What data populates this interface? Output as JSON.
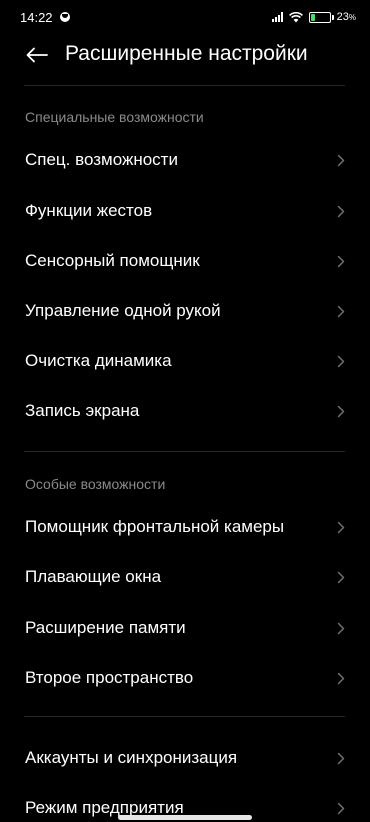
{
  "status_bar": {
    "time": "14:22",
    "battery_percent_label": "23",
    "battery_percent_suffix": "%",
    "battery_level": 0.23,
    "battery_color": "#4cd964"
  },
  "header": {
    "title": "Расширенные настройки",
    "back_icon": "arrow-left-icon"
  },
  "sections": [
    {
      "title": "Специальные возможности",
      "items": [
        {
          "label": "Спец. возможности"
        },
        {
          "label": "Функции жестов"
        },
        {
          "label": "Сенсорный помощник"
        },
        {
          "label": "Управление одной рукой"
        },
        {
          "label": "Очистка динамика"
        },
        {
          "label": "Запись экрана"
        }
      ]
    },
    {
      "title": "Особые возможности",
      "items": [
        {
          "label": "Помощник фронтальной камеры"
        },
        {
          "label": "Плавающие окна"
        },
        {
          "label": "Расширение памяти"
        },
        {
          "label": "Второе пространство"
        }
      ]
    },
    {
      "title": "",
      "items": [
        {
          "label": "Аккаунты и синхронизация"
        },
        {
          "label": "Режим предприятия"
        }
      ]
    }
  ],
  "colors": {
    "background": "#000000",
    "text": "#ffffff",
    "section_title": "#8a8a8a",
    "chevron": "#6f6f6f",
    "divider": "#262626"
  }
}
